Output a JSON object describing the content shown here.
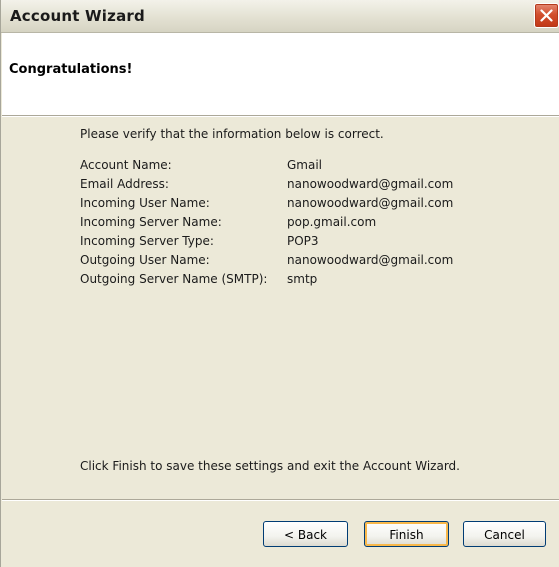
{
  "window": {
    "title": "Account Wizard"
  },
  "header": {
    "title": "Congratulations!"
  },
  "main": {
    "intro": "Please verify that the information below is correct.",
    "rows": [
      {
        "label": "Account Name:",
        "value": "Gmail"
      },
      {
        "label": "Email Address:",
        "value": "nanowoodward@gmail.com"
      },
      {
        "label": "Incoming User Name:",
        "value": "nanowoodward@gmail.com"
      },
      {
        "label": "Incoming Server Name:",
        "value": "pop.gmail.com"
      },
      {
        "label": "Incoming Server Type:",
        "value": "POP3"
      },
      {
        "label": "Outgoing User Name:",
        "value": "nanowoodward@gmail.com"
      },
      {
        "label": "Outgoing Server Name (SMTP):",
        "value": "smtp"
      }
    ],
    "finish_note": "Click Finish to save these settings and exit the Account Wizard."
  },
  "buttons": {
    "back": "< Back",
    "finish": "Finish",
    "cancel": "Cancel"
  },
  "icons": {
    "close": "close-icon"
  },
  "colors": {
    "dialog_bg": "#ece9d8",
    "close_button": "#d24f2e",
    "default_button_focus": "#f8b84b"
  }
}
